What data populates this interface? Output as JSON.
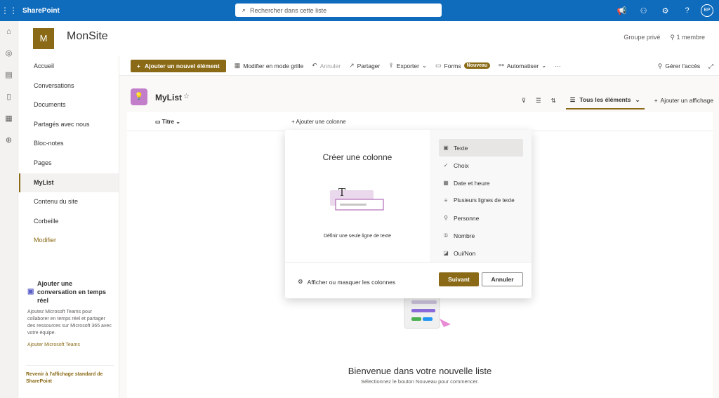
{
  "app": {
    "name": "SharePoint"
  },
  "search": {
    "placeholder": "Rechercher dans cette liste"
  },
  "user": {
    "initials": "BP"
  },
  "site": {
    "logo_letter": "M",
    "name": "MonSite",
    "privacy": "Groupe privé",
    "members": "1 membre"
  },
  "nav": {
    "items": [
      {
        "label": "Accueil"
      },
      {
        "label": "Conversations"
      },
      {
        "label": "Documents"
      },
      {
        "label": "Partagés avec nous"
      },
      {
        "label": "Bloc-notes"
      },
      {
        "label": "Pages"
      },
      {
        "label": "MyList"
      },
      {
        "label": "Contenu du site"
      },
      {
        "label": "Corbeille"
      },
      {
        "label": "Modifier"
      }
    ],
    "selected": "MyList"
  },
  "teams": {
    "title": "Ajouter une conversation en temps réel",
    "desc": "Ajoutez Microsoft Teams pour collaborer en temps réel et partager des ressources sur Microsoft 365 avec votre équipe.",
    "link": "Ajouter Microsoft Teams"
  },
  "revert": "Revenir à l'affichage standard de SharePoint",
  "commands": {
    "new": "Ajouter un nouvel élément",
    "grid": "Modifier en mode grille",
    "undo": "Annuler",
    "share": "Partager",
    "export": "Exporter",
    "forms": "Forms",
    "new_badge": "Nouveau",
    "automate": "Automatiser",
    "more": "···",
    "access": "Gérer l'accès"
  },
  "list": {
    "name": "MyList",
    "view": "Tous les éléments",
    "add_view": "Ajouter un affichage",
    "col_title": "Titre",
    "add_column": "Ajouter une colonne",
    "welcome_title": "Bienvenue dans votre nouvelle liste",
    "welcome_sub": "Sélectionnez le bouton Nouveau pour commencer."
  },
  "panel": {
    "title": "Créer une colonne",
    "desc": "Définir une seule ligne de texte",
    "options": [
      {
        "label": "Texte",
        "icon": "text-icon"
      },
      {
        "label": "Choix",
        "icon": "choice-icon"
      },
      {
        "label": "Date et heure",
        "icon": "calendar-icon"
      },
      {
        "label": "Plusieurs lignes de texte",
        "icon": "multiline-icon"
      },
      {
        "label": "Personne",
        "icon": "person-icon"
      },
      {
        "label": "Nombre",
        "icon": "number-icon"
      },
      {
        "label": "Oui/Non",
        "icon": "yesno-icon"
      }
    ],
    "selected": "Texte",
    "toggle": "Afficher ou masquer les colonnes",
    "next": "Suivant",
    "cancel": "Annuler"
  },
  "colors": {
    "brand": "#0f6cbd",
    "accent": "#8a6a16",
    "list_icon": "#c27ec9"
  }
}
